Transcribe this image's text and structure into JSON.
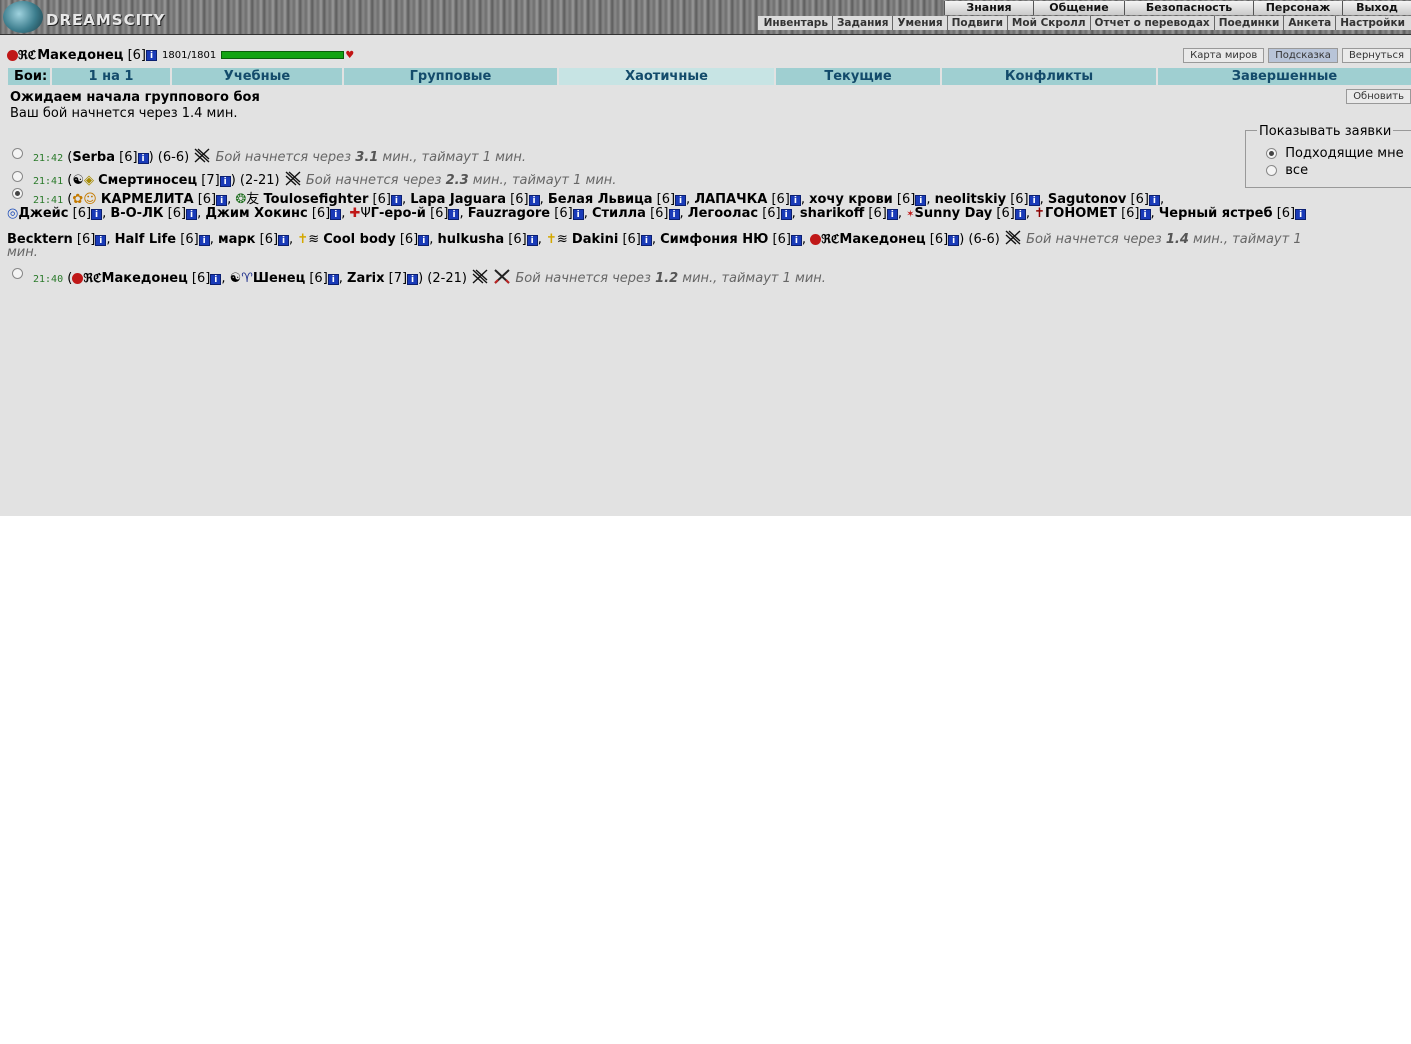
{
  "header": {
    "logo": "DREAMSCITY",
    "menu_top": [
      "Знания",
      "Общение",
      "Безопасность",
      "Персонаж",
      "Выход"
    ],
    "menu_sub": [
      "Инвентарь",
      "Задания",
      "Умения",
      "Подвиги",
      "Мой Скролл",
      "Отчет о переводах",
      "Поединки",
      "Анкета",
      "Настройки"
    ]
  },
  "character": {
    "name": "Македонец",
    "level": "[6]",
    "hp": "1801/1801",
    "hp_fraction": 1.0
  },
  "top_buttons": {
    "map": "Карта миров",
    "hint": "Подсказка",
    "back": "Вернуться"
  },
  "tabs": {
    "label": "Бои:",
    "items": [
      "1 на 1",
      "Учебные",
      "Групповые",
      "Хаотичные",
      "Текущие",
      "Конфликты",
      "Завершенные"
    ],
    "active": "Хаотичные"
  },
  "waiting": {
    "title": "Ожидаем начала группового боя",
    "subtitle": "Ваш бой начнется через 1.4 мин.",
    "refresh": "Обновить"
  },
  "filter": {
    "legend": "Показывать заявки",
    "option_suitable": "Подходящие мне",
    "option_all": "все"
  },
  "battles": [
    {
      "time": "21:42",
      "players": [
        {
          "name": "Serba",
          "level": "[6]"
        }
      ],
      "range": "(6-6)",
      "note_prefix": "Бой начнется через",
      "minutes": "3.1",
      "note_suffix": "мин., таймаут 1 мин."
    },
    {
      "time": "21:41",
      "players": [
        {
          "name": "Смертиносец",
          "level": "[7]"
        }
      ],
      "range": "(2-21)",
      "note_prefix": "Бой начнется через",
      "minutes": "2.3",
      "note_suffix": "мин., таймаут 1 мин."
    },
    {
      "time": "21:41",
      "players": [
        {
          "name": "КАРМЕЛИТА",
          "level": "[6]"
        },
        {
          "name": "Toulosefighter",
          "level": "[6]"
        },
        {
          "name": "Lapa Jaguara",
          "level": "[6]"
        },
        {
          "name": "Белая Львица",
          "level": "[6]"
        },
        {
          "name": "ЛАПАЧКА",
          "level": "[6]"
        },
        {
          "name": "хочу крови",
          "level": "[6]"
        },
        {
          "name": "neolitskiy",
          "level": "[6]"
        },
        {
          "name": "Sagutonov",
          "level": "[6]"
        },
        {
          "name": "Джейс",
          "level": "[6]"
        },
        {
          "name": "В-О-ЛК",
          "level": "[6]"
        },
        {
          "name": "Джим Хокинс",
          "level": "[6]"
        },
        {
          "name": "Г-еро-й",
          "level": "[6]"
        },
        {
          "name": "Fauzragore",
          "level": "[6]"
        },
        {
          "name": "Стилла",
          "level": "[6]"
        },
        {
          "name": "Легоолас",
          "level": "[6]"
        },
        {
          "name": "sharikoff",
          "level": "[6]"
        },
        {
          "name": "Sunny Day",
          "level": "[6]"
        },
        {
          "name": "ГОНОМЕТ",
          "level": "[6]"
        },
        {
          "name": "Черный ястреб",
          "level": "[6]"
        },
        {
          "name": "Becktern",
          "level": "[6]"
        },
        {
          "name": "Half Life",
          "level": "[6]"
        },
        {
          "name": "марк",
          "level": "[6]"
        },
        {
          "name": "Cool body",
          "level": "[6]"
        },
        {
          "name": "hulkusha",
          "level": "[6]"
        },
        {
          "name": "Dakini",
          "level": "[6]"
        },
        {
          "name": "Симфония НЮ",
          "level": "[6]"
        },
        {
          "name": "Македонец",
          "level": "[6]"
        }
      ],
      "range": "(6-6)",
      "note_prefix": "Бой начнется через",
      "minutes": "1.4",
      "note_suffix": "мин., таймаут 1",
      "note_wrap": "мин."
    },
    {
      "time": "21:40",
      "players": [
        {
          "name": "Македонец",
          "level": "[6]"
        },
        {
          "name": "Шенец",
          "level": "[6]"
        },
        {
          "name": "Zarix",
          "level": "[7]"
        }
      ],
      "range": "(2-21)",
      "note_prefix": "Бой начнется через",
      "minutes": "1.2",
      "note_suffix": "мин., таймаут 1 мин."
    }
  ],
  "colors": {
    "bg": "#e2e2e2",
    "tab": "#9fcfd1",
    "tab_active": "#c7e4e4",
    "tab_text": "#134b6b",
    "hp": "#13a313",
    "time": "#2a7a2a"
  }
}
